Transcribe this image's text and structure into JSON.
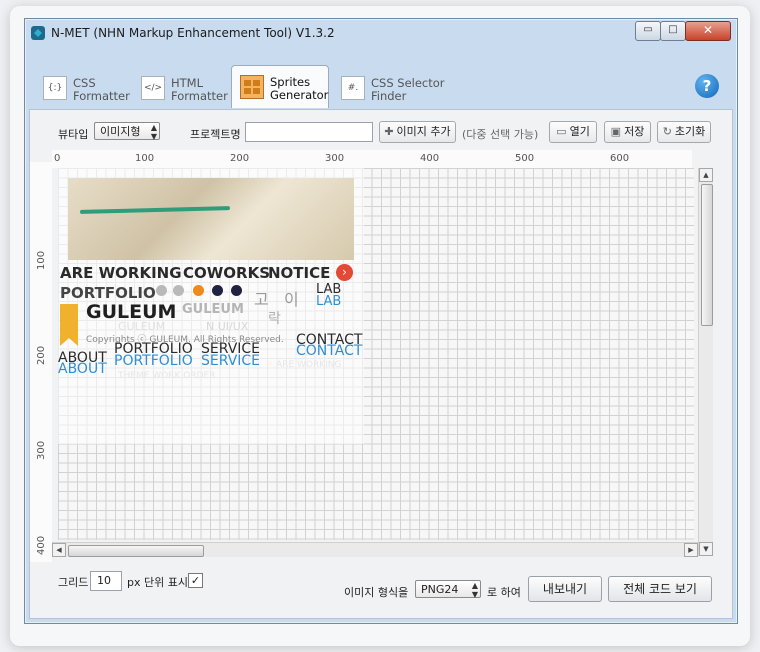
{
  "window": {
    "title": "N-MET (NHN Markup Enhancement Tool) V1.3.2",
    "min_glyph": "▭",
    "max_glyph": "□",
    "close_glyph": "✕"
  },
  "tabs": [
    {
      "line1": "CSS",
      "line2": "Formatter",
      "icon": "{:}"
    },
    {
      "line1": "HTML",
      "line2": "Formatter",
      "icon": "</>"
    },
    {
      "line1": "Sprites",
      "line2": "Generator",
      "icon": ""
    },
    {
      "line1": "CSS Selector",
      "line2": "Finder",
      "icon": "#."
    }
  ],
  "help_glyph": "?",
  "toolbar": {
    "viewtype_label": "뷰타입",
    "viewtype_value": "이미지형",
    "project_label": "프로젝트명",
    "project_value": "",
    "add_image": "이미지 추가",
    "add_hint": "(다중 선택 가능)",
    "open": "열기",
    "save": "저장",
    "reset": "초기화"
  },
  "ruler": {
    "top": [
      "0",
      "100",
      "200",
      "300",
      "400",
      "500",
      "600"
    ],
    "left": [
      "100",
      "200",
      "300",
      "400"
    ]
  },
  "sprite_texts": {
    "are_working": "ARE WORKING",
    "coworks": "COWORKS",
    "notice": "NOTICE",
    "portfolio": "PORTFOLIO",
    "lab1": "LAB",
    "lab2": "LAB",
    "ko1": "고",
    "ko2": "이",
    "ko3": "락",
    "guleum": "GULEUM",
    "guleum_gray": "GULEUM",
    "faint1": "N  UI/UX",
    "faint2": "GULEUM",
    "copyright": "Copyrights ⓒ GULEUM. All Rights Reserved.",
    "contact1": "CONTACT",
    "contact2": "CONTACT",
    "about1": "ABOUT",
    "about2": "ABOUT",
    "portfolio2": "PORTFOLIO",
    "portfolio3": "PORTFOLIO",
    "service1": "SERVICE",
    "service2": "SERVICE",
    "are_working2": "ARE WORKING",
    "theme_order": "THEME WORK ORDER"
  },
  "bottom": {
    "grid_label": "그리드",
    "grid_value": "10",
    "grid_unit": "px 단위 표시",
    "check": "✓",
    "format_label": "이미지 형식을",
    "format_value": "PNG24",
    "format_suffix": "로 하여",
    "export": "내보내기",
    "view_code": "전체 코드 보기"
  },
  "colors": {
    "accent_blue": "#2e8fd6",
    "orange_dot": "#f08a1c",
    "navy_dot": "#1f2240",
    "red_close": "#e24a35",
    "gold": "#f0b22c"
  }
}
